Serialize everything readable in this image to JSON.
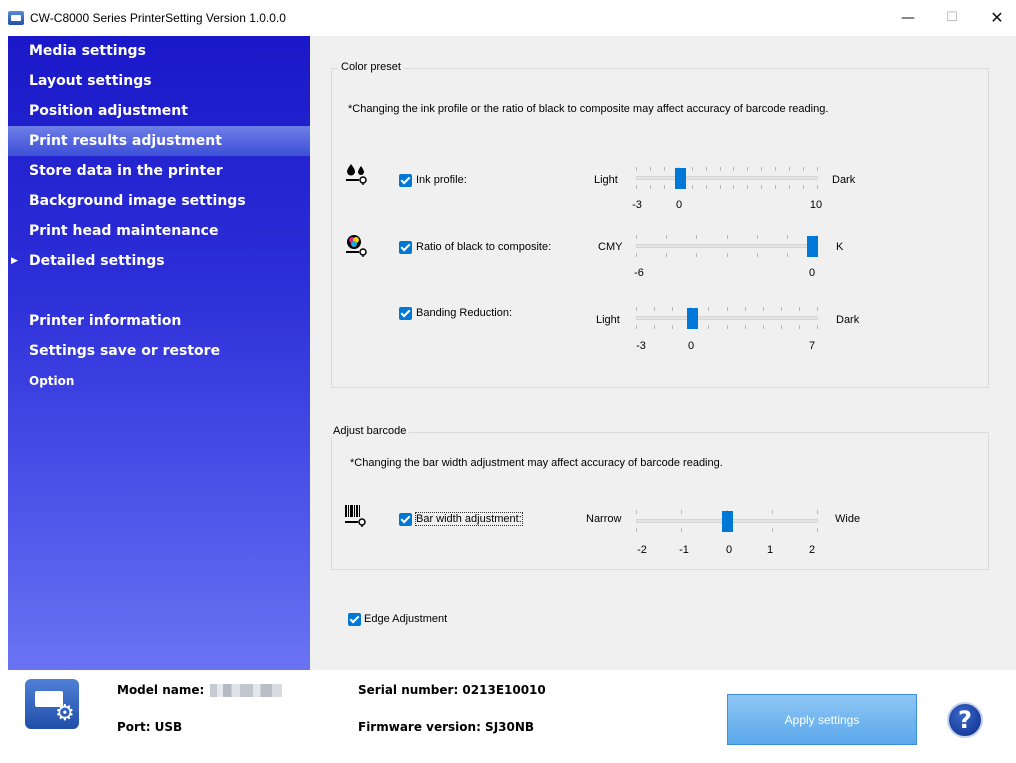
{
  "window": {
    "title": "CW-C8000 Series PrinterSetting Version 1.0.0.0",
    "minimize": "—",
    "maximize": "☐",
    "close": "✕"
  },
  "sidebar": {
    "items": [
      {
        "label": "Media settings"
      },
      {
        "label": "Layout settings"
      },
      {
        "label": "Position adjustment"
      },
      {
        "label": "Print results adjustment",
        "selected": true
      },
      {
        "label": "Store data in the printer"
      },
      {
        "label": "Background image settings"
      },
      {
        "label": "Print head maintenance"
      },
      {
        "label": "Detailed settings",
        "arrow": "▶"
      },
      {
        "label": "Printer information"
      },
      {
        "label": "Settings save or restore"
      },
      {
        "label": "Option"
      }
    ]
  },
  "color_preset": {
    "title": "Color preset",
    "note": "*Changing the ink profile or the ratio of black to composite may affect accuracy of barcode reading.",
    "ink_profile": {
      "label": "Ink profile:",
      "checked": true,
      "left": "Light",
      "right": "Dark",
      "min_label": "-3",
      "zero_label": "0",
      "max_label": "10",
      "min": -3,
      "max": 10,
      "value": 0
    },
    "ratio": {
      "label": "Ratio of black to composite:",
      "checked": true,
      "left": "CMY",
      "right": "K",
      "min_label": "-6",
      "max_label": "0",
      "min": -6,
      "max": 0,
      "value": 0
    },
    "banding": {
      "label": "Banding Reduction:",
      "checked": true,
      "left": "Light",
      "right": "Dark",
      "min_label": "-3",
      "zero_label": "0",
      "max_label": "7",
      "min": -3,
      "max": 7,
      "value": 0
    }
  },
  "adjust_barcode": {
    "title": "Adjust barcode",
    "note": "*Changing the bar width adjustment may affect accuracy of barcode reading.",
    "bar_width": {
      "label": "Bar width adjustment:",
      "checked": true,
      "left": "Narrow",
      "right": "Wide",
      "tick_labels": [
        "-2",
        "-1",
        "0",
        "1",
        "2"
      ],
      "min": -2,
      "max": 2,
      "value": 0
    }
  },
  "edge_adjustment": {
    "label": "Edge Adjustment",
    "checked": true
  },
  "footer": {
    "model_label": "Model name:",
    "port": "Port: USB",
    "serial": "Serial number: 0213E10010",
    "firmware": "Firmware version: SJ30NB",
    "apply": "Apply settings",
    "help": "?"
  }
}
